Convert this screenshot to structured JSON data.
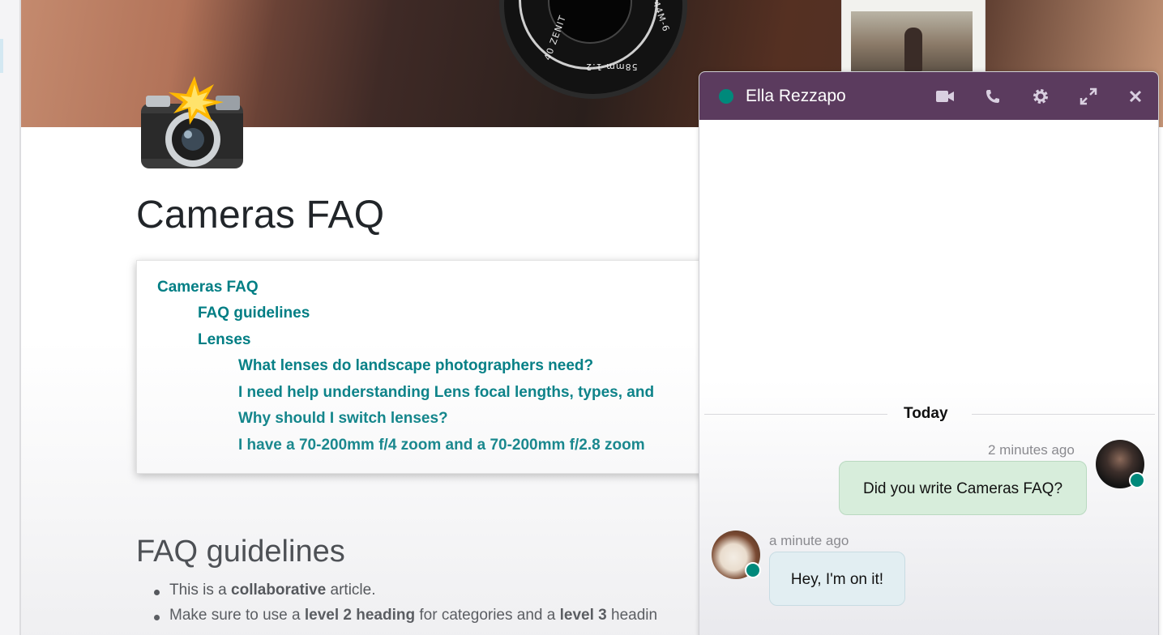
{
  "document": {
    "title": "Cameras FAQ",
    "toc": [
      {
        "label": "Cameras FAQ",
        "level": 1
      },
      {
        "label": "FAQ guidelines",
        "level": 2
      },
      {
        "label": "Lenses",
        "level": 2
      },
      {
        "label": "What lenses do landscape photographers need?",
        "level": 3
      },
      {
        "label": "I need help understanding Lens focal lengths, types, and",
        "level": 3
      },
      {
        "label": "Why should I switch lenses?",
        "level": 3
      },
      {
        "label": "I have a 70-200mm f/4 zoom and a 70-200mm f/2.8 zoom",
        "level": 3
      }
    ],
    "section_heading": "FAQ guidelines",
    "bullets": [
      {
        "pre": "This is a ",
        "bold": "collaborative",
        "post": " article."
      },
      {
        "pre": "Make sure to use a ",
        "bold": "level 2 heading",
        "post": " for categories and a ",
        "bold2": "level 3",
        "post2": " headin"
      }
    ]
  },
  "cover": {
    "lens_text_1": "40 ZENIT",
    "lens_text_2": "58mm 1:2",
    "lens_text_3": "44M-6"
  },
  "chat": {
    "contact_name": "Ella Rezzapo",
    "status_color": "#00897b",
    "header_color": "#5b3b5e",
    "icons": [
      "video-icon",
      "phone-icon",
      "gear-icon",
      "expand-icon",
      "close-icon"
    ],
    "date_separator": "Today",
    "messages": [
      {
        "author": "me",
        "time": "2 minutes ago",
        "text": "Did you write Cameras FAQ?"
      },
      {
        "author": "Ella Rezzapo",
        "time": "a minute ago",
        "text": "Hey, I'm on it!"
      }
    ]
  },
  "colors": {
    "accent": "#017e84",
    "sent_bubble": "#d7eddb",
    "received_bubble": "#e2eef2"
  }
}
